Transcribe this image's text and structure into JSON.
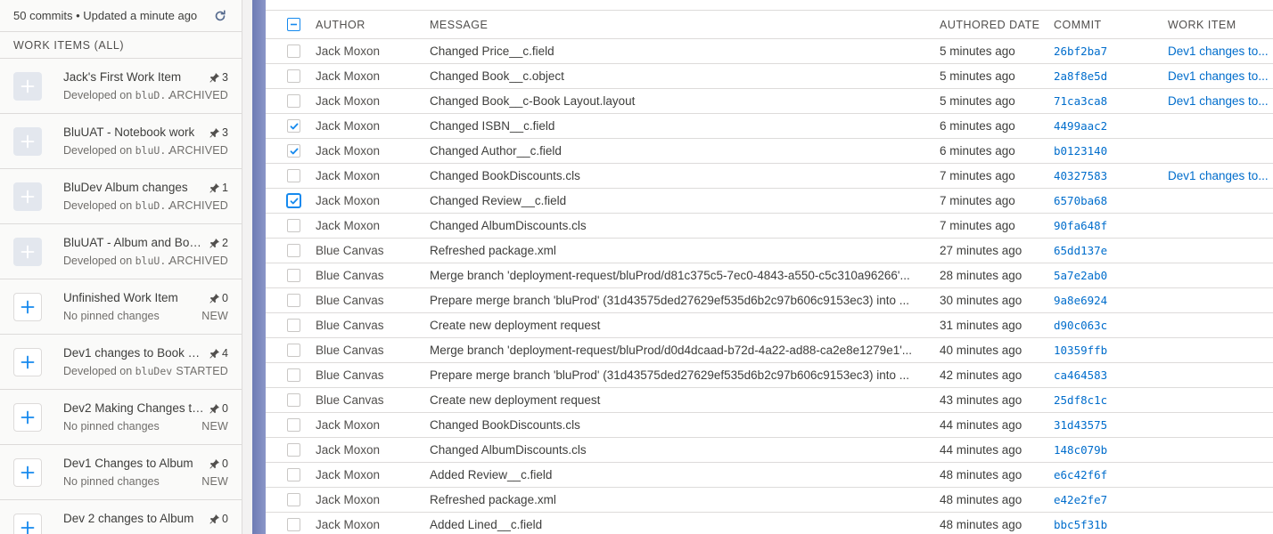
{
  "sidebar": {
    "summary": "50 commits • Updated a minute ago",
    "section_header": "WORK ITEMS (ALL)",
    "items": [
      {
        "title": "Jack's First Work Item",
        "pins": "3",
        "sub_prefix": "Developed on ",
        "sub_branch": "bluD...",
        "status": "ARCHIVED",
        "archived": true
      },
      {
        "title": "BluUAT - Notebook work",
        "pins": "3",
        "sub_prefix": "Developed on ",
        "sub_branch": "bluU...",
        "status": "ARCHIVED",
        "archived": true
      },
      {
        "title": "BluDev Album changes",
        "pins": "1",
        "sub_prefix": "Developed on ",
        "sub_branch": "bluD...",
        "status": "ARCHIVED",
        "archived": true
      },
      {
        "title": "BluUAT - Album and Boo...",
        "pins": "2",
        "sub_prefix": "Developed on ",
        "sub_branch": "bluU...",
        "status": "ARCHIVED",
        "archived": true
      },
      {
        "title": "Unfinished Work Item",
        "pins": "0",
        "sub_prefix": "No pinned changes",
        "sub_branch": "",
        "status": "NEW",
        "archived": false
      },
      {
        "title": "Dev1 changes to Book O...",
        "pins": "4",
        "sub_prefix": "Developed on ",
        "sub_branch": "bluDev",
        "status": "STARTED",
        "archived": false
      },
      {
        "title": "Dev2 Making Changes to...",
        "pins": "0",
        "sub_prefix": "No pinned changes",
        "sub_branch": "",
        "status": "NEW",
        "archived": false
      },
      {
        "title": "Dev1 Changes to Album",
        "pins": "0",
        "sub_prefix": "No pinned changes",
        "sub_branch": "",
        "status": "NEW",
        "archived": false
      },
      {
        "title": "Dev 2 changes to Album",
        "pins": "0",
        "sub_prefix": "",
        "sub_branch": "",
        "status": "",
        "archived": false
      }
    ]
  },
  "table": {
    "headers": {
      "author": "AUTHOR",
      "message": "MESSAGE",
      "date": "AUTHORED DATE",
      "commit": "COMMIT",
      "work_item": "WORK ITEM"
    },
    "rows": [
      {
        "checked": false,
        "focus": false,
        "author": "Jack Moxon",
        "message": "Changed Price__c.field",
        "date": "5 minutes ago",
        "commit": "26bf2ba7",
        "work_item": "Dev1 changes to..."
      },
      {
        "checked": false,
        "focus": false,
        "author": "Jack Moxon",
        "message": "Changed Book__c.object",
        "date": "5 minutes ago",
        "commit": "2a8f8e5d",
        "work_item": "Dev1 changes to..."
      },
      {
        "checked": false,
        "focus": false,
        "author": "Jack Moxon",
        "message": "Changed Book__c-Book Layout.layout",
        "date": "5 minutes ago",
        "commit": "71ca3ca8",
        "work_item": "Dev1 changes to..."
      },
      {
        "checked": true,
        "focus": false,
        "author": "Jack Moxon",
        "message": "Changed ISBN__c.field",
        "date": "6 minutes ago",
        "commit": "4499aac2",
        "work_item": ""
      },
      {
        "checked": true,
        "focus": false,
        "author": "Jack Moxon",
        "message": "Changed Author__c.field",
        "date": "6 minutes ago",
        "commit": "b0123140",
        "work_item": ""
      },
      {
        "checked": false,
        "focus": false,
        "author": "Jack Moxon",
        "message": "Changed BookDiscounts.cls",
        "date": "7 minutes ago",
        "commit": "40327583",
        "work_item": "Dev1 changes to..."
      },
      {
        "checked": true,
        "focus": true,
        "author": "Jack Moxon",
        "message": "Changed Review__c.field",
        "date": "7 minutes ago",
        "commit": "6570ba68",
        "work_item": ""
      },
      {
        "checked": false,
        "focus": false,
        "author": "Jack Moxon",
        "message": "Changed AlbumDiscounts.cls",
        "date": "7 minutes ago",
        "commit": "90fa648f",
        "work_item": ""
      },
      {
        "checked": false,
        "focus": false,
        "author": "Blue Canvas",
        "message": "Refreshed package.xml",
        "date": "27 minutes ago",
        "commit": "65dd137e",
        "work_item": ""
      },
      {
        "checked": false,
        "focus": false,
        "author": "Blue Canvas",
        "message": "Merge branch 'deployment-request/bluProd/d81c375c5-7ec0-4843-a550-c5c310a96266'...",
        "date": "28 minutes ago",
        "commit": "5a7e2ab0",
        "work_item": ""
      },
      {
        "checked": false,
        "focus": false,
        "author": "Blue Canvas",
        "message": "Prepare merge branch 'bluProd' (31d43575ded27629ef535d6b2c97b606c9153ec3) into ...",
        "date": "30 minutes ago",
        "commit": "9a8e6924",
        "work_item": ""
      },
      {
        "checked": false,
        "focus": false,
        "author": "Blue Canvas",
        "message": "Create new deployment request",
        "date": "31 minutes ago",
        "commit": "d90c063c",
        "work_item": ""
      },
      {
        "checked": false,
        "focus": false,
        "author": "Blue Canvas",
        "message": "Merge branch 'deployment-request/bluProd/d0d4dcaad-b72d-4a22-ad88-ca2e8e1279e1'...",
        "date": "40 minutes ago",
        "commit": "10359ffb",
        "work_item": ""
      },
      {
        "checked": false,
        "focus": false,
        "author": "Blue Canvas",
        "message": "Prepare merge branch 'bluProd' (31d43575ded27629ef535d6b2c97b606c9153ec3) into ...",
        "date": "42 minutes ago",
        "commit": "ca464583",
        "work_item": ""
      },
      {
        "checked": false,
        "focus": false,
        "author": "Blue Canvas",
        "message": "Create new deployment request",
        "date": "43 minutes ago",
        "commit": "25df8c1c",
        "work_item": ""
      },
      {
        "checked": false,
        "focus": false,
        "author": "Jack Moxon",
        "message": "Changed BookDiscounts.cls",
        "date": "44 minutes ago",
        "commit": "31d43575",
        "work_item": ""
      },
      {
        "checked": false,
        "focus": false,
        "author": "Jack Moxon",
        "message": "Changed AlbumDiscounts.cls",
        "date": "44 minutes ago",
        "commit": "148c079b",
        "work_item": ""
      },
      {
        "checked": false,
        "focus": false,
        "author": "Jack Moxon",
        "message": "Added Review__c.field",
        "date": "48 minutes ago",
        "commit": "e6c42f6f",
        "work_item": ""
      },
      {
        "checked": false,
        "focus": false,
        "author": "Jack Moxon",
        "message": "Refreshed package.xml",
        "date": "48 minutes ago",
        "commit": "e42e2fe7",
        "work_item": ""
      },
      {
        "checked": false,
        "focus": false,
        "author": "Jack Moxon",
        "message": "Added Lined__c.field",
        "date": "48 minutes ago",
        "commit": "bbc5f31b",
        "work_item": ""
      }
    ]
  },
  "icons": {
    "refresh": "refresh-icon",
    "add": "add-icon",
    "pin": "pin-icon",
    "check": "check-icon",
    "minus": "minus-icon"
  },
  "colors": {
    "link": "#006dcc",
    "accent": "#1589ee",
    "archived_tile": "#e3e7ee",
    "gutter": "#7b87bf"
  }
}
